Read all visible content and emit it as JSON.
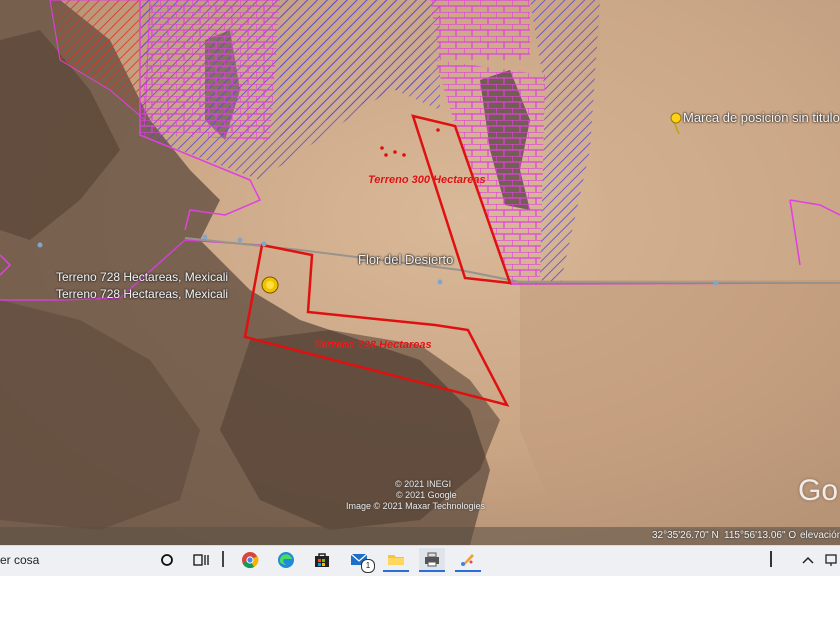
{
  "map": {
    "labels": {
      "terreno_300": "Terreno 300 Hectareas",
      "terreno_728_red": "Terreno 728 Hectareas",
      "terreno_728_white_1": "Terreno 728 Hectareas, Mexicali",
      "terreno_728_white_2": "Terreno 728 Hectareas, Mexicali",
      "road": "Flor del Desierto",
      "placemark": "Marca de posición sin titulo"
    },
    "credits": {
      "line1": "© 2021 INEGI",
      "line2": "© 2021 Google",
      "line3": "Image © 2021 Maxar Technologies"
    },
    "coords": {
      "lat": "32°35'26.70\" N",
      "lon": "115°56'13.06\" O",
      "elevation_label": "elevación"
    },
    "google_logo": "Go",
    "colors": {
      "boundary_red": "#e01010",
      "hatch_magenta": "#e040e0",
      "hatch_blue": "#5a48d8",
      "hatch_red": "#e03020"
    }
  },
  "taskbar": {
    "search_text": "er cosa",
    "icons": [
      "search-circle-icon",
      "task-view-icon",
      "chrome-icon",
      "edge-icon",
      "store-icon",
      "mail-icon",
      "file-explorer-icon",
      "printer-icon",
      "paint-icon"
    ],
    "mail_badge": "1"
  }
}
